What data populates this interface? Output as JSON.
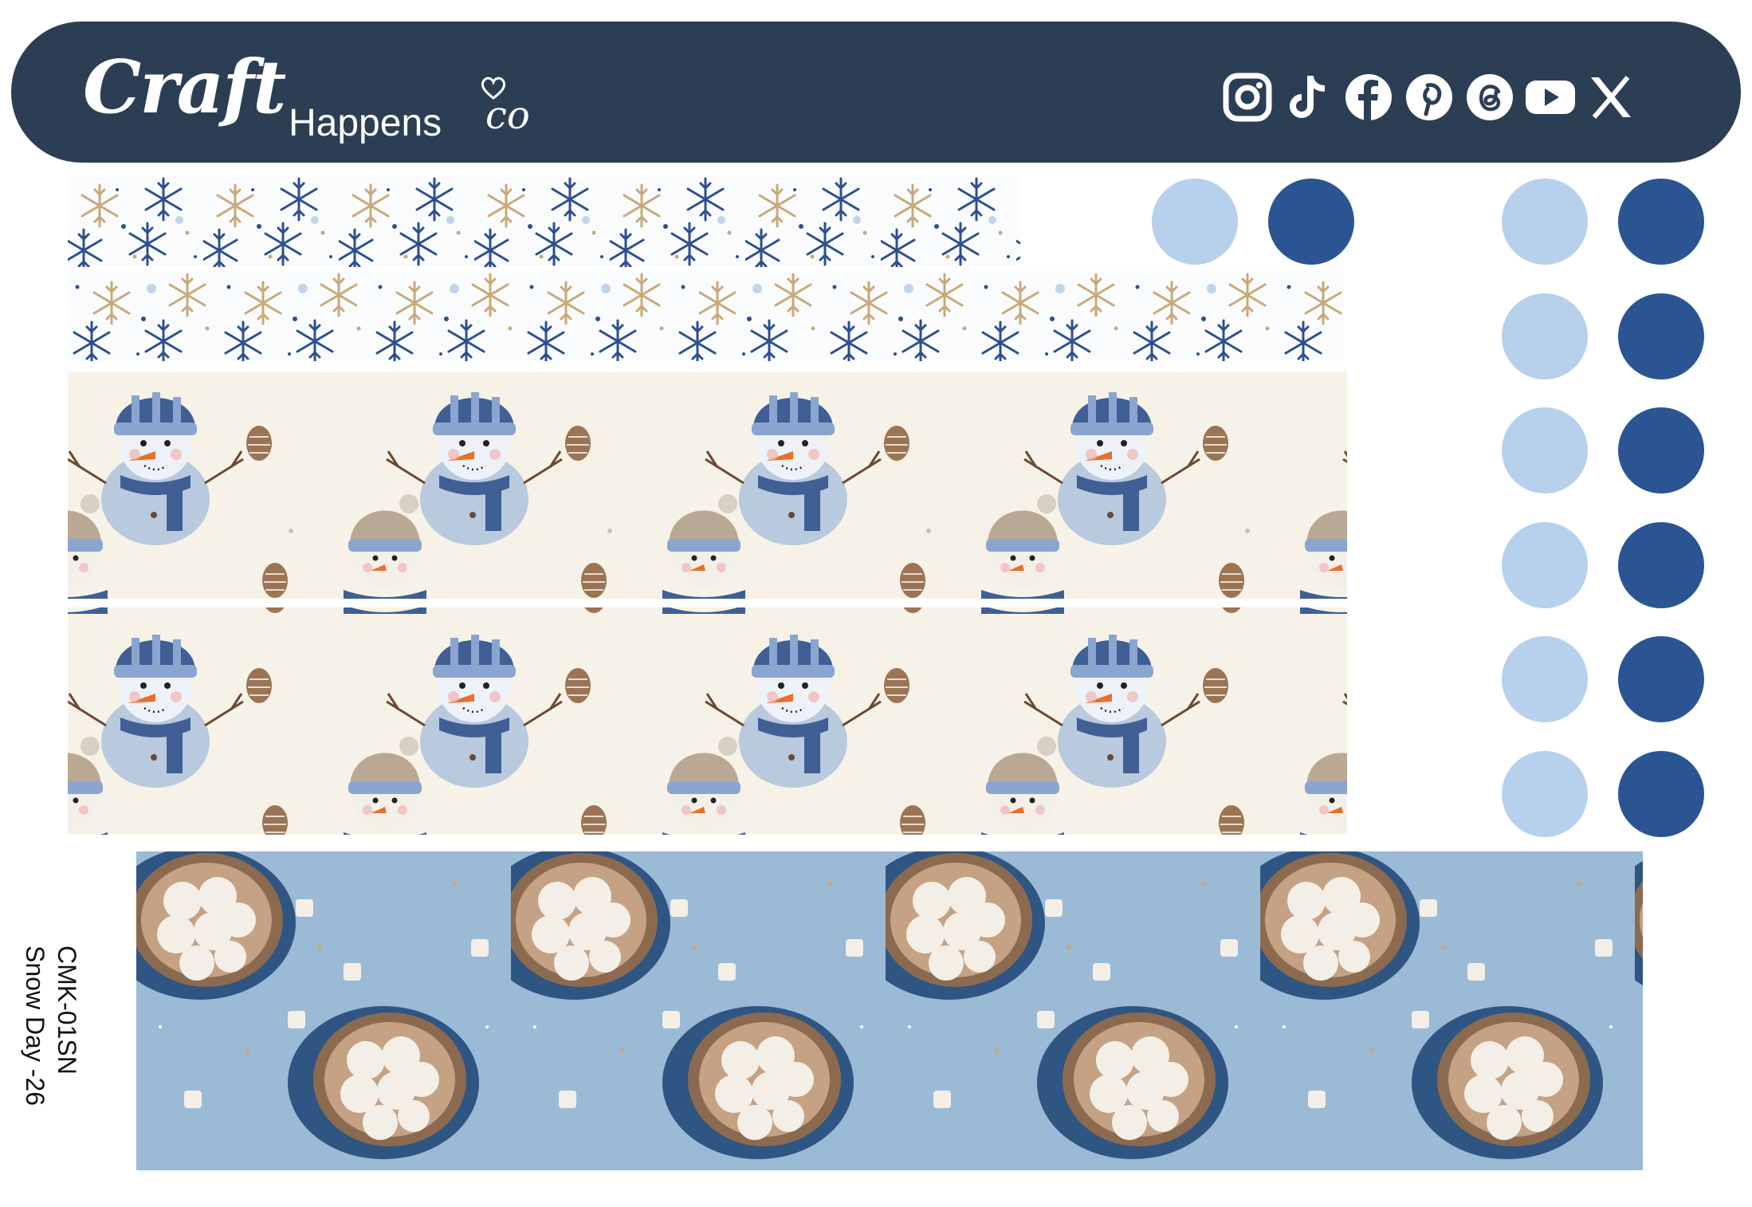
{
  "brand": {
    "logo_script": "Craft",
    "logo_sans": "Happens",
    "logo_suffix": "co"
  },
  "social_icons": [
    "instagram-icon",
    "tiktok-icon",
    "facebook-icon",
    "pinterest-icon",
    "threads-icon",
    "youtube-icon",
    "x-icon"
  ],
  "product": {
    "code": "CMK-01SN",
    "name": "Snow Day -26"
  },
  "colors": {
    "header": "#2c3e54",
    "light_blue": "#b7d0ec",
    "dark_blue": "#2a5592",
    "snowflake_blue": "#2d4f8f",
    "snowflake_gold": "#c8a977",
    "cream": "#f7f2e7",
    "cocoa_bg": "#9bbad6"
  },
  "swatches": {
    "top_pair": [
      "#b7d0ec",
      "#2a5592"
    ],
    "grid_rows": 6,
    "grid": [
      "#b7d0ec",
      "#2a5592"
    ]
  }
}
